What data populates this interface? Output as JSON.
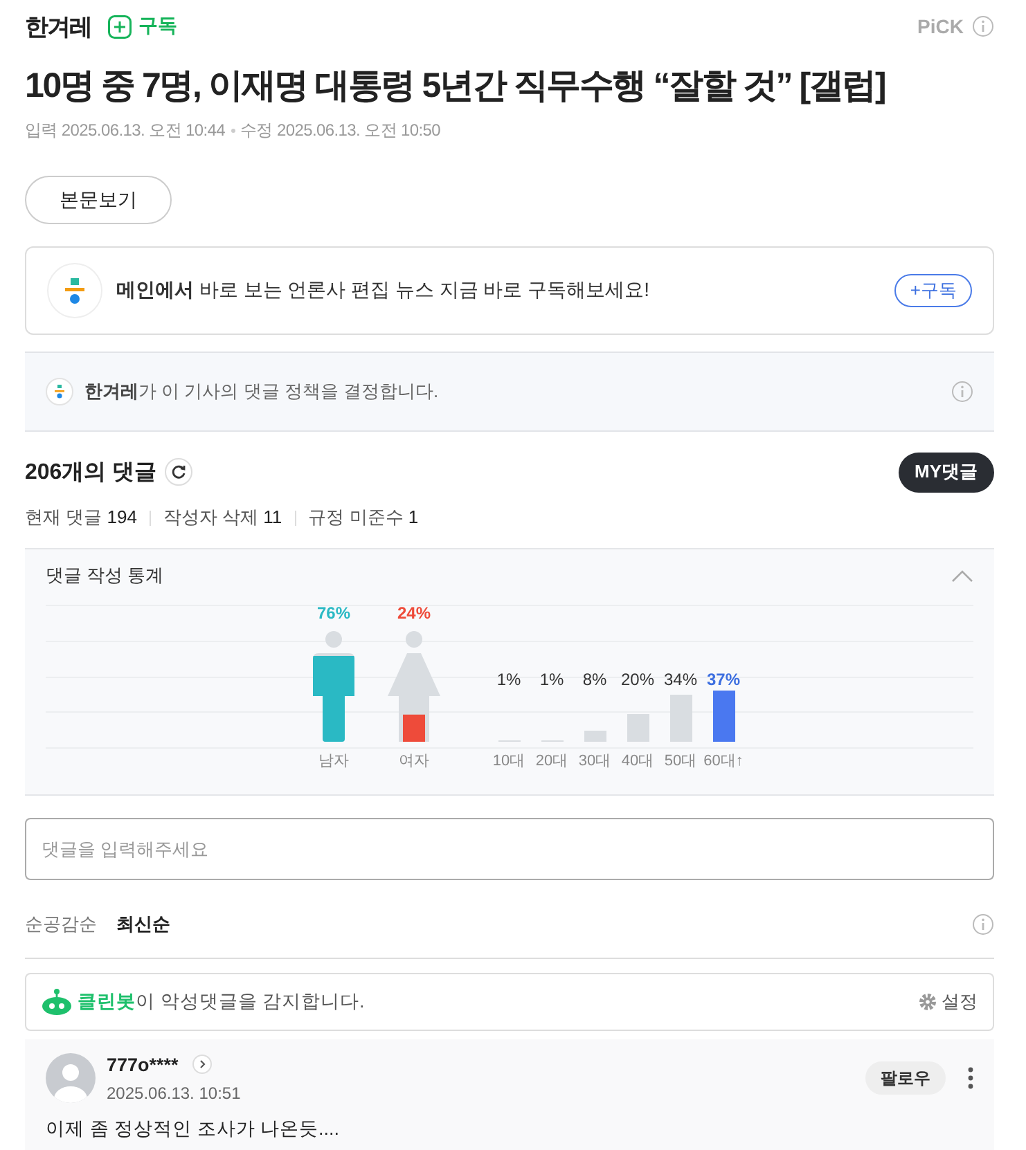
{
  "header": {
    "press": "한겨레",
    "subscribe": "구독",
    "pick": "PiCK"
  },
  "article": {
    "title": "10명 중 7명, 이재명 대통령 5년간 직무수행 “잘할 것” [갤럽]",
    "input_date": "입력 2025.06.13. 오전 10:44",
    "edit_date": "수정 2025.06.13. 오전 10:50",
    "view_button": "본문보기"
  },
  "promo": {
    "text": "**메인에서** 바로 보는 언론사 편집 뉴스 지금 바로 구독해보세요!",
    "button": "+구독"
  },
  "policy": {
    "text": "**한겨레**가 이 기사의 댓글 정책을 결정합니다."
  },
  "comments": {
    "count": "206",
    "count_suffix": "개의 댓글",
    "my_button": "MY댓글",
    "stats": [
      {
        "label": "현재 댓글",
        "value": "194"
      },
      {
        "label": "작성자 삭제",
        "value": "11"
      },
      {
        "label": "규정 미준수",
        "value": "1"
      }
    ]
  },
  "statistics": {
    "title": "댓글 작성 통계",
    "expanded": true,
    "gender": [
      {
        "label": "남자",
        "value": "76%",
        "color": "#2ab9c4"
      },
      {
        "label": "여자",
        "value": "24%",
        "color": "#ee4b3a"
      }
    ],
    "age": [
      {
        "label": "10대",
        "value": "1%",
        "highlight": false
      },
      {
        "label": "20대",
        "value": "1%",
        "highlight": false
      },
      {
        "label": "30대",
        "value": "8%",
        "highlight": false
      },
      {
        "label": "40대",
        "value": "20%",
        "highlight": false
      },
      {
        "label": "50대",
        "value": "34%",
        "highlight": false
      },
      {
        "label": "60대↑",
        "value": "37%",
        "highlight": true
      }
    ]
  },
  "comment_input": {
    "placeholder": "댓글을 입력해주세요"
  },
  "sort_tabs": [
    {
      "label": "순공감순",
      "selected": false
    },
    {
      "label": "최신순",
      "selected": true
    }
  ],
  "cleanbot": {
    "text": "**클린봇**이 악성댓글을 감지합니다.",
    "settings": "설정"
  },
  "comment_list": [
    {
      "author": "777o****",
      "date": "2025.06.13. 10:51",
      "follow": "팔로우",
      "text": "이제 좀 정상적인 조사가 나온듯...."
    }
  ]
}
